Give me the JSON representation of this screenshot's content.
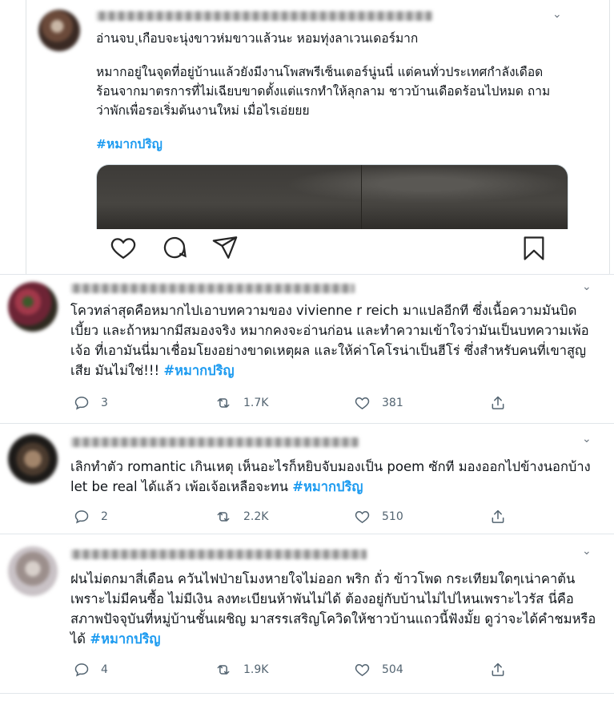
{
  "main_tweet": {
    "text_line_1": "อ่านจบ ุเกือบจะนุ่งขาวห่มขาวแล้วนะ  หอมทุ่งลาเวนเดอร์มาก",
    "text_para_2": "หมากอยู่ในจุดที่อยู่บ้านแล้วยังมีงานโพสพรีเซ็นเตอร์นู่นนี่  แต่คนทั่วประเทศกำลังเดือดร้อนจากมาตรการที่ไม่เฉียบขาดตั้งแต่แรกทำให้ลุกลาม ชาวบ้านเดือดร้อนไปหมด ถามว่าพักเพื่อรอเริ่มต้นงานใหม่  เมื่อไรเอ่ยยย",
    "hashtag": "#หมากปริญ"
  },
  "replies": [
    {
      "text": "โควทล่าสุดคือหมากไปเอาบทความของ vivienne r reich มาแปลอีกที ซึ่งเนื้อความมันบิดเบี้ยว และถ้าหมากมีสมองจริง หมากคงจะอ่านก่อน และทำความเข้าใจว่ามันเป็นบทความเพ้อเจ้อ ที่เอามันนี่มาเชื่อมโยงอย่างขาดเหตุผล และให้ค่าโคโรน่าเป็นฮีโร่ ซึ่งสำหรับคนที่เขาสูญเสีย มันไม่ใช่!!! ",
      "hashtag": "#หมากปริญ",
      "replies_count": "3",
      "retweets": "1.7K",
      "likes": "381"
    },
    {
      "text": "เลิกทำตัว romantic เกินเหตุ เห็นอะไรก็หยิบจับมองเป็น poem ซักที มองออกไปข้างนอกบ้าง let be real ได้แล้ว เพ้อเจ้อเหลือจะทน ",
      "hashtag": "#หมากปริญ",
      "replies_count": "2",
      "retweets": "2.2K",
      "likes": "510"
    },
    {
      "text": "ฝนไม่ตกมาสี่เดือน ควันไฟป่ายโมงหายใจไม่ออก พริก ถั่ว ข้าวโพด กระเทียมใดๆเน่าคาต้นเพราะไม่มีคนซื้อ ไม่มีเงิน ลงทะเบียนห้าพันไม่ได้ ต้องอยู่กับบ้านไม่ไปไหนเพราะไวรัส นี่คือสภาพปัจจุบันที่หมู่บ้านชั้นเผชิญ มาสรรเสริญโควิดให้ชาวบ้านแถวนี้ฟังมั้ย ดูว่าจะได้คำชมหรือได้ ",
      "hashtag": "#หมากปริญ",
      "replies_count": "4",
      "retweets": "1.9K",
      "likes": "504"
    }
  ],
  "colors": {
    "accent": "#1d9bf0",
    "icon": "#536471"
  },
  "icons": [
    "chevron-down-icon",
    "heart-icon",
    "comment-icon",
    "share-icon",
    "bookmark-icon",
    "reply-icon",
    "retweet-icon",
    "like-icon",
    "upload-icon"
  ]
}
